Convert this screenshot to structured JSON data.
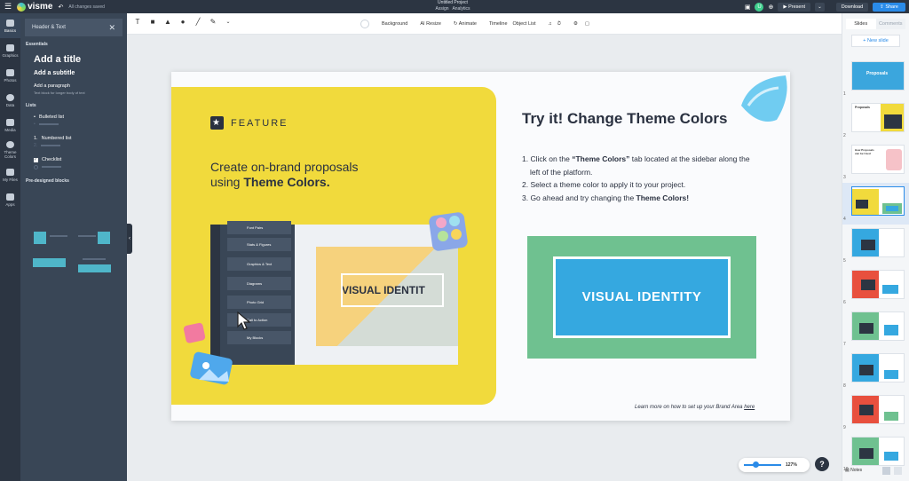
{
  "topbar": {
    "logo": "visme",
    "saved": "All changes saved",
    "project_title": "Untitled Project",
    "assign": "Assign",
    "analytics": "Analytics",
    "avatar": "U",
    "present": "Present",
    "download": "Download",
    "share": "Share"
  },
  "rail": [
    {
      "label": "Basics"
    },
    {
      "label": "Graphics"
    },
    {
      "label": "Photos"
    },
    {
      "label": "Data"
    },
    {
      "label": "Media"
    },
    {
      "label": "Theme Colors"
    },
    {
      "label": "My Files"
    },
    {
      "label": "Apps"
    }
  ],
  "panel": {
    "header": "Header & Text",
    "essentials": "Essentials",
    "add_title": "Add a title",
    "add_subtitle": "Add a subtitle",
    "add_paragraph": "Add a paragraph",
    "paragraph_desc": "Text block for longer body of text",
    "lists": "Lists",
    "bulleted": "Bulleted list",
    "numbered": "Numbered list",
    "checklist": "Checklist",
    "predesigned": "Pre-designed blocks"
  },
  "toolbar": {
    "background": "Background",
    "ai_resize": "AI Resize",
    "animate": "Animate",
    "timeline": "Timeline",
    "object_list": "Object List"
  },
  "slide": {
    "feature": "FEATURE",
    "headline_1": "Create on-brand proposals",
    "headline_2": "using ",
    "headline_bold": "Theme Colors.",
    "mock_items": [
      "Font Pairs",
      "Stats & Figures",
      "Graphics & Text",
      "Diagrams",
      "Photo Grid",
      "Call to Action",
      "My Blocks"
    ],
    "mock_vi": "VISUAL IDENTIT",
    "try_title": "Try it! Change Theme Colors",
    "step1_a": "1. Click on the ",
    "step1_b": "“Theme Colors”",
    "step1_c": " tab located at the sidebar along the left of the platform.",
    "step2": "2. Select a theme color to apply it to your project.",
    "step3_a": "3. Go ahead and try changing the ",
    "step3_b": "Theme Colors!",
    "visual_identity": "VISUAL IDENTITY",
    "learn_more": "Learn more on how to  set up your Brand Area ",
    "here": "here"
  },
  "zoom": {
    "level": "127%"
  },
  "help": "?",
  "right_panel": {
    "tab_slides": "Slides",
    "tab_comments": "Comments",
    "new_slide": "+ New slide",
    "thumb1_title": "Proposals",
    "thumb2_title": "Proposals",
    "thumb3_title": "How Proposals can be Used",
    "slide_numbers": [
      "1",
      "2",
      "3",
      "4",
      "5",
      "6",
      "7",
      "8",
      "9",
      "10"
    ],
    "selected_slide": 4,
    "notes": "Notes"
  },
  "colors": {
    "yellow": "#f1da3c",
    "green": "#6fc190",
    "blue": "#35a8e0",
    "dark": "#2c3542",
    "accent": "#2a8be8"
  }
}
